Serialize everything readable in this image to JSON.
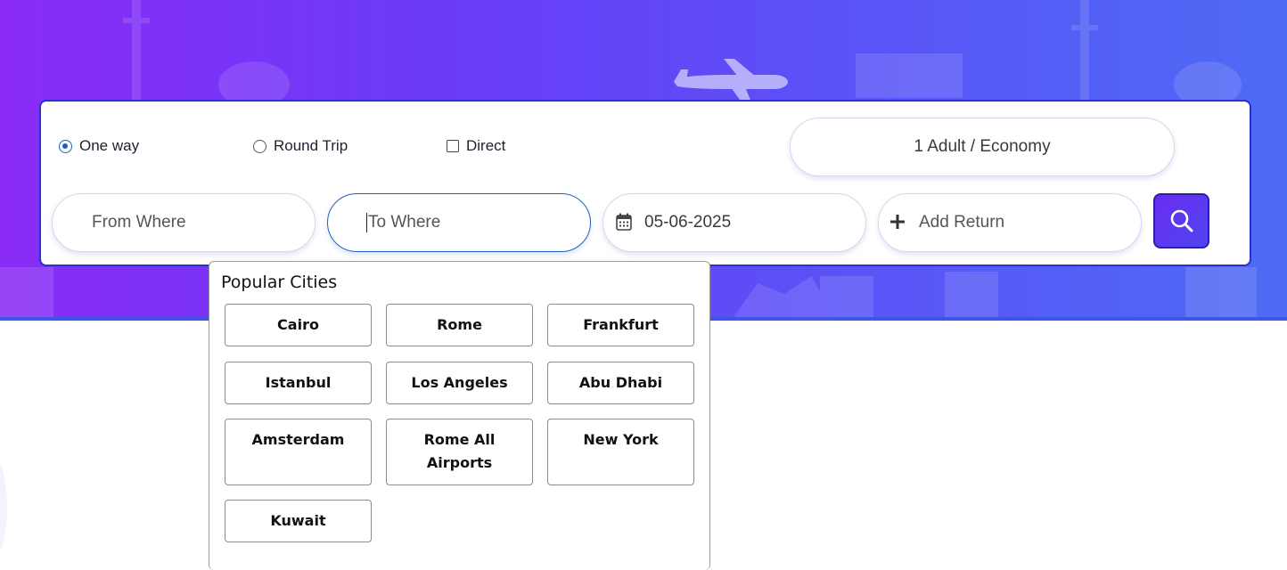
{
  "trip_options": {
    "one_way": {
      "label": "One way",
      "selected": true
    },
    "round_trip": {
      "label": "Round Trip",
      "selected": false
    },
    "direct": {
      "label": "Direct",
      "checked": false
    }
  },
  "passengers": {
    "label": "1 Adult / Economy"
  },
  "fields": {
    "from": {
      "placeholder": "From Where"
    },
    "to": {
      "placeholder": "To Where"
    },
    "date": {
      "value": "05-06-2025",
      "icon": "calendar-icon"
    },
    "return": {
      "label": "Add Return",
      "icon": "plus-icon"
    }
  },
  "search_button": {
    "icon": "search-icon"
  },
  "popular": {
    "title": "Popular Cities",
    "cities": [
      "Cairo",
      "Rome",
      "Frankfurt",
      "Istanbul",
      "Los Angeles",
      "Abu Dhabi",
      "Amsterdam",
      "Rome All Airports",
      "New York",
      "Kuwait"
    ]
  },
  "colors": {
    "accent": "#1363c6",
    "hero_start": "#8a2cf6",
    "hero_end": "#4e6bf5",
    "search_button": "#5a3af0"
  }
}
